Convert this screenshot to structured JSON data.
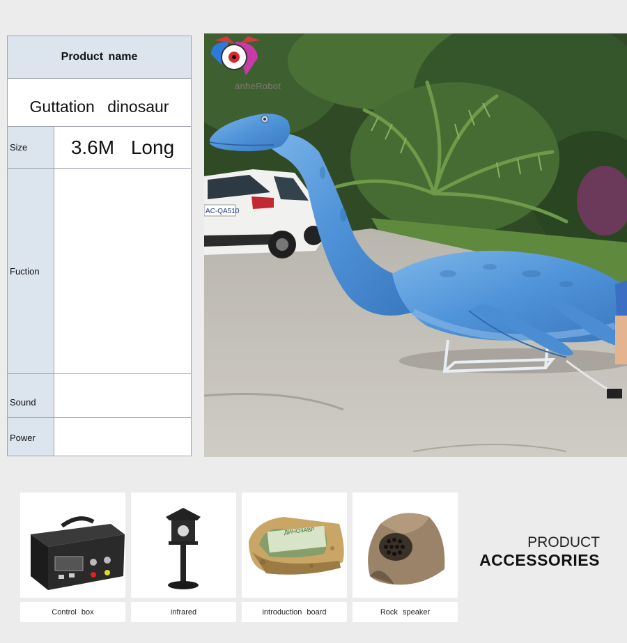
{
  "spec_table": {
    "header": "Product name",
    "product_name": "Guttation dinosaur",
    "rows": [
      {
        "label": "Size",
        "value": "3.6M Long"
      },
      {
        "label": "Fuction",
        "value": ""
      },
      {
        "label": "Sound",
        "value": ""
      },
      {
        "label": "Power",
        "value": ""
      }
    ]
  },
  "photo": {
    "logo_text": "anheRobot",
    "car_plate": "AC-QA510"
  },
  "accessories": {
    "title_line1": "PRODUCT",
    "title_line2": "ACCESSORIES",
    "items": [
      {
        "caption": "Control box"
      },
      {
        "caption": "infrared"
      },
      {
        "caption": "introduction board"
      },
      {
        "caption": "Rock speaker"
      }
    ],
    "board_text": "ДИНОЗАВР"
  },
  "colors": {
    "table_label_bg": "#dce4ee",
    "table_border": "#9ea3ad",
    "dino_blue": "#4f93d8"
  }
}
